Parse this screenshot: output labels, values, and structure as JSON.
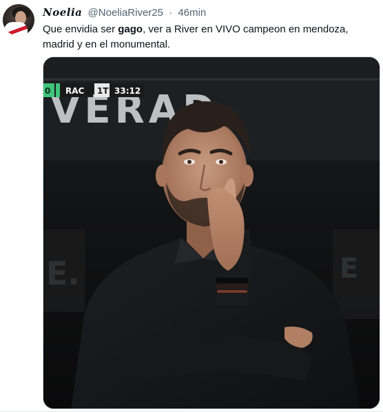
{
  "tweet": {
    "author_name": "Noelia",
    "handle": "@NoeliaRiver25",
    "separator": "·",
    "time": "46min",
    "text_before": "Que envidia ser ",
    "text_bold": "gago",
    "text_after": ", ver a River en VIVO campeon en mendoza, madrid y en el monumental."
  },
  "media": {
    "scoreboard": {
      "left_score": "0",
      "team": "RAC",
      "period": "1T",
      "clock": "33:12"
    },
    "background_text": "VERAD"
  },
  "colors": {
    "text": "#0f1419",
    "muted": "#536471",
    "scoreboard_team_bg": "#1a1a1a",
    "scoreboard_green": "#3fc47a"
  }
}
